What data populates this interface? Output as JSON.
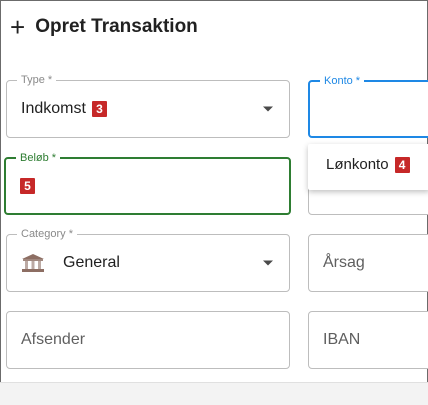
{
  "header": {
    "plus": "+",
    "title": "Opret Transaktion"
  },
  "fields": {
    "type": {
      "label": "Type *",
      "value": "Indkomst",
      "badge": "3"
    },
    "konto": {
      "label": "Konto *"
    },
    "belob": {
      "label": "Beløb *",
      "badge": "5"
    },
    "category": {
      "label": "Category *",
      "value": "General",
      "icon": "bank-icon"
    },
    "arsag": {
      "placeholder": "Årsag"
    },
    "afsender": {
      "placeholder": "Afsender"
    },
    "iban": {
      "placeholder": "IBAN"
    }
  },
  "dropdown": {
    "item": "Lønkonto",
    "badge": "4"
  },
  "colors": {
    "focus_blue": "#1e88e5",
    "focus_green": "#2e7d32",
    "badge_red": "#c62828"
  }
}
